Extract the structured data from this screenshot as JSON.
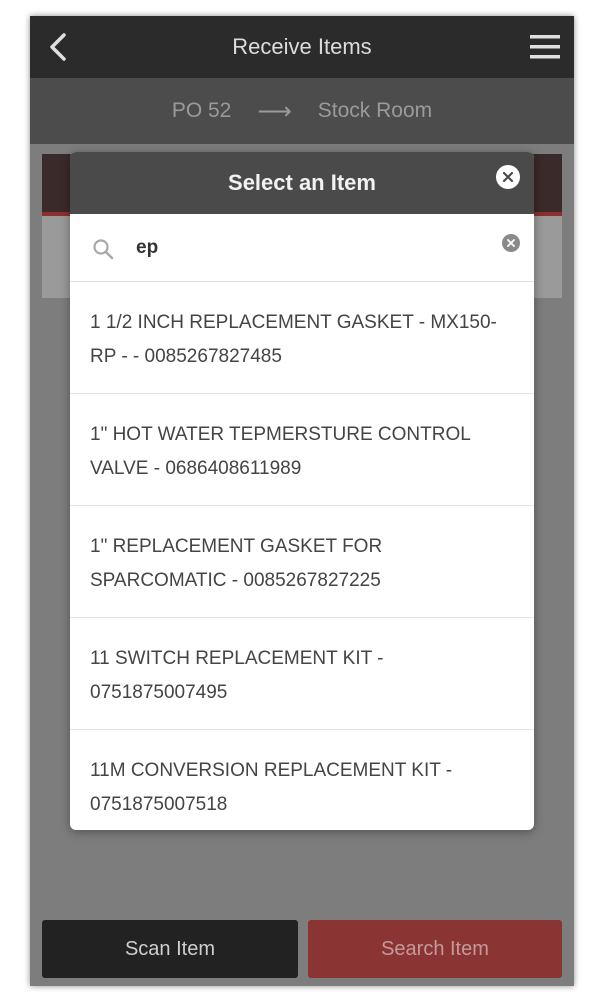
{
  "header": {
    "title": "Receive Items",
    "back_icon": "chevron-left-icon",
    "menu_icon": "hamburger-menu-icon"
  },
  "route": {
    "from": "PO 52",
    "arrow": "⟶",
    "to": "Stock Room"
  },
  "modal": {
    "title": "Select an Item",
    "close_icon": "close-icon",
    "search": {
      "value": "ep",
      "icon": "search-icon",
      "clear_icon": "clear-icon"
    },
    "items": [
      {
        "label": "1 1/2 INCH REPLACEMENT GASKET - MX150-RP - - 0085267827485"
      },
      {
        "label": "1\" HOT WATER TEPMERSTURE CONTROL VALVE - 0686408611989"
      },
      {
        "label": "1\" REPLACEMENT GASKET FOR SPARCOMATIC - 0085267827225"
      },
      {
        "label": "11 SWITCH REPLACEMENT KIT - 0751875007495"
      },
      {
        "label": "11M CONVERSION REPLACEMENT KIT - 0751875007518"
      }
    ]
  },
  "actions": {
    "scan_label": "Scan Item",
    "search_label": "Search Item"
  },
  "colors": {
    "topbar": "#2b2b2b",
    "route_bar": "#4c4c4c",
    "modal_header": "#4a4a4a",
    "accent_red": "#8a3434",
    "scan_button": "#222222"
  }
}
